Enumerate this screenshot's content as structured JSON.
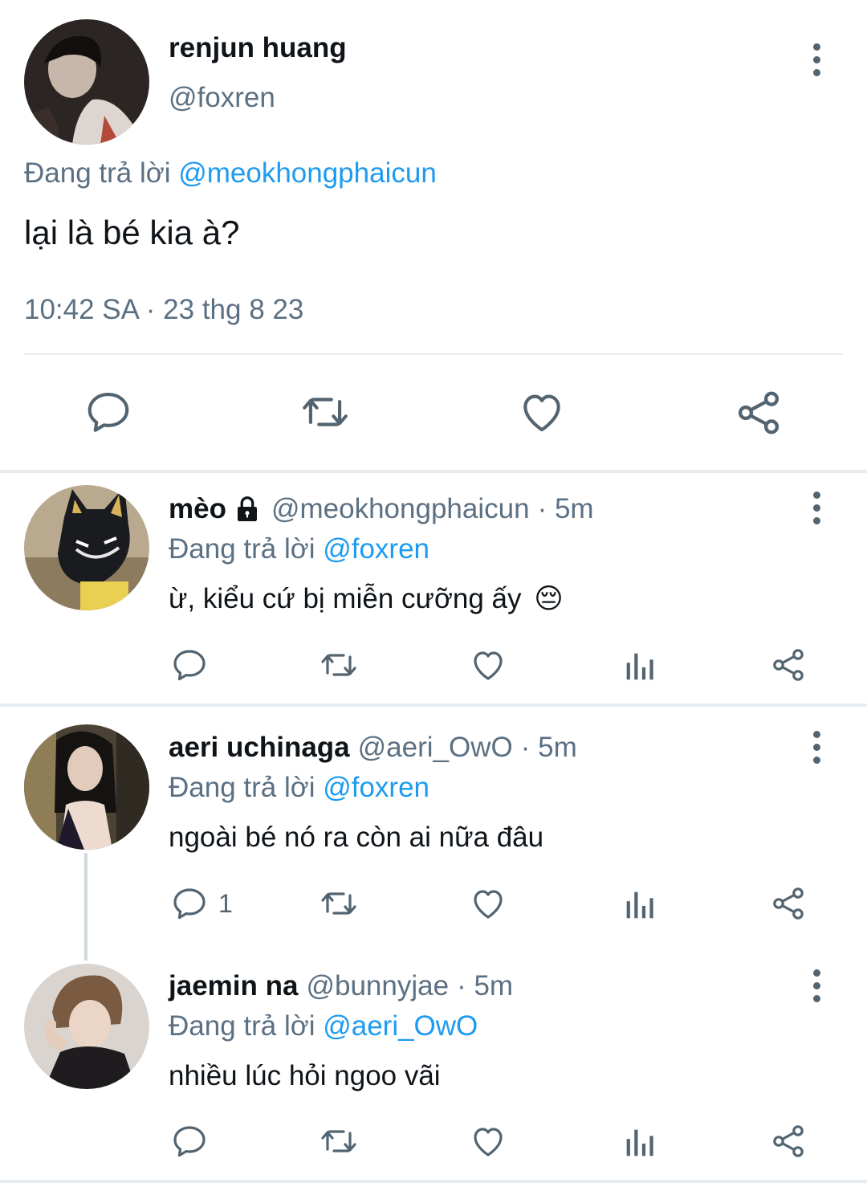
{
  "main_tweet": {
    "name": "renjun huang",
    "handle": "@foxren",
    "replying_prefix": "Đang trả lời ",
    "replying_to": "@meokhongphaicun",
    "text": "lại là bé kia à?",
    "timestamp": "10:42 SA · 23 thg 8 23"
  },
  "replies": [
    {
      "name": "mèo",
      "handle": "@meokhongphaicun",
      "time": "· 5m",
      "protected": true,
      "replying_prefix": "Đang trả lời ",
      "replying_to": "@foxren",
      "text": "ừ, kiểu cứ bị miễn cưỡng ấy",
      "emoji": "😔",
      "reply_count": ""
    },
    {
      "name": "aeri uchinaga",
      "handle": "@aeri_OwO",
      "time": "· 5m",
      "protected": false,
      "replying_prefix": "Đang trả lời ",
      "replying_to": "@foxren",
      "text": "ngoài bé nó ra còn ai nữa đâu",
      "emoji": "",
      "reply_count": "1"
    },
    {
      "name": "jaemin na",
      "handle": "@bunnyjae",
      "time": "· 5m",
      "protected": false,
      "replying_prefix": "Đang trả lời ",
      "replying_to": "@aeri_OwO",
      "text": "nhiều lúc hỏi ngoo vãi",
      "emoji": "",
      "reply_count": ""
    }
  ],
  "icons": {
    "reply": "reply-icon",
    "retweet": "retweet-icon",
    "like": "heart-icon",
    "analytics": "analytics-icon",
    "share": "share-icon",
    "more": "more-vertical-icon",
    "lock": "lock-icon"
  },
  "colors": {
    "link": "#1d9bf0",
    "muted": "#5b7083",
    "icon": "#536471",
    "separator": "#e6ecf0"
  }
}
